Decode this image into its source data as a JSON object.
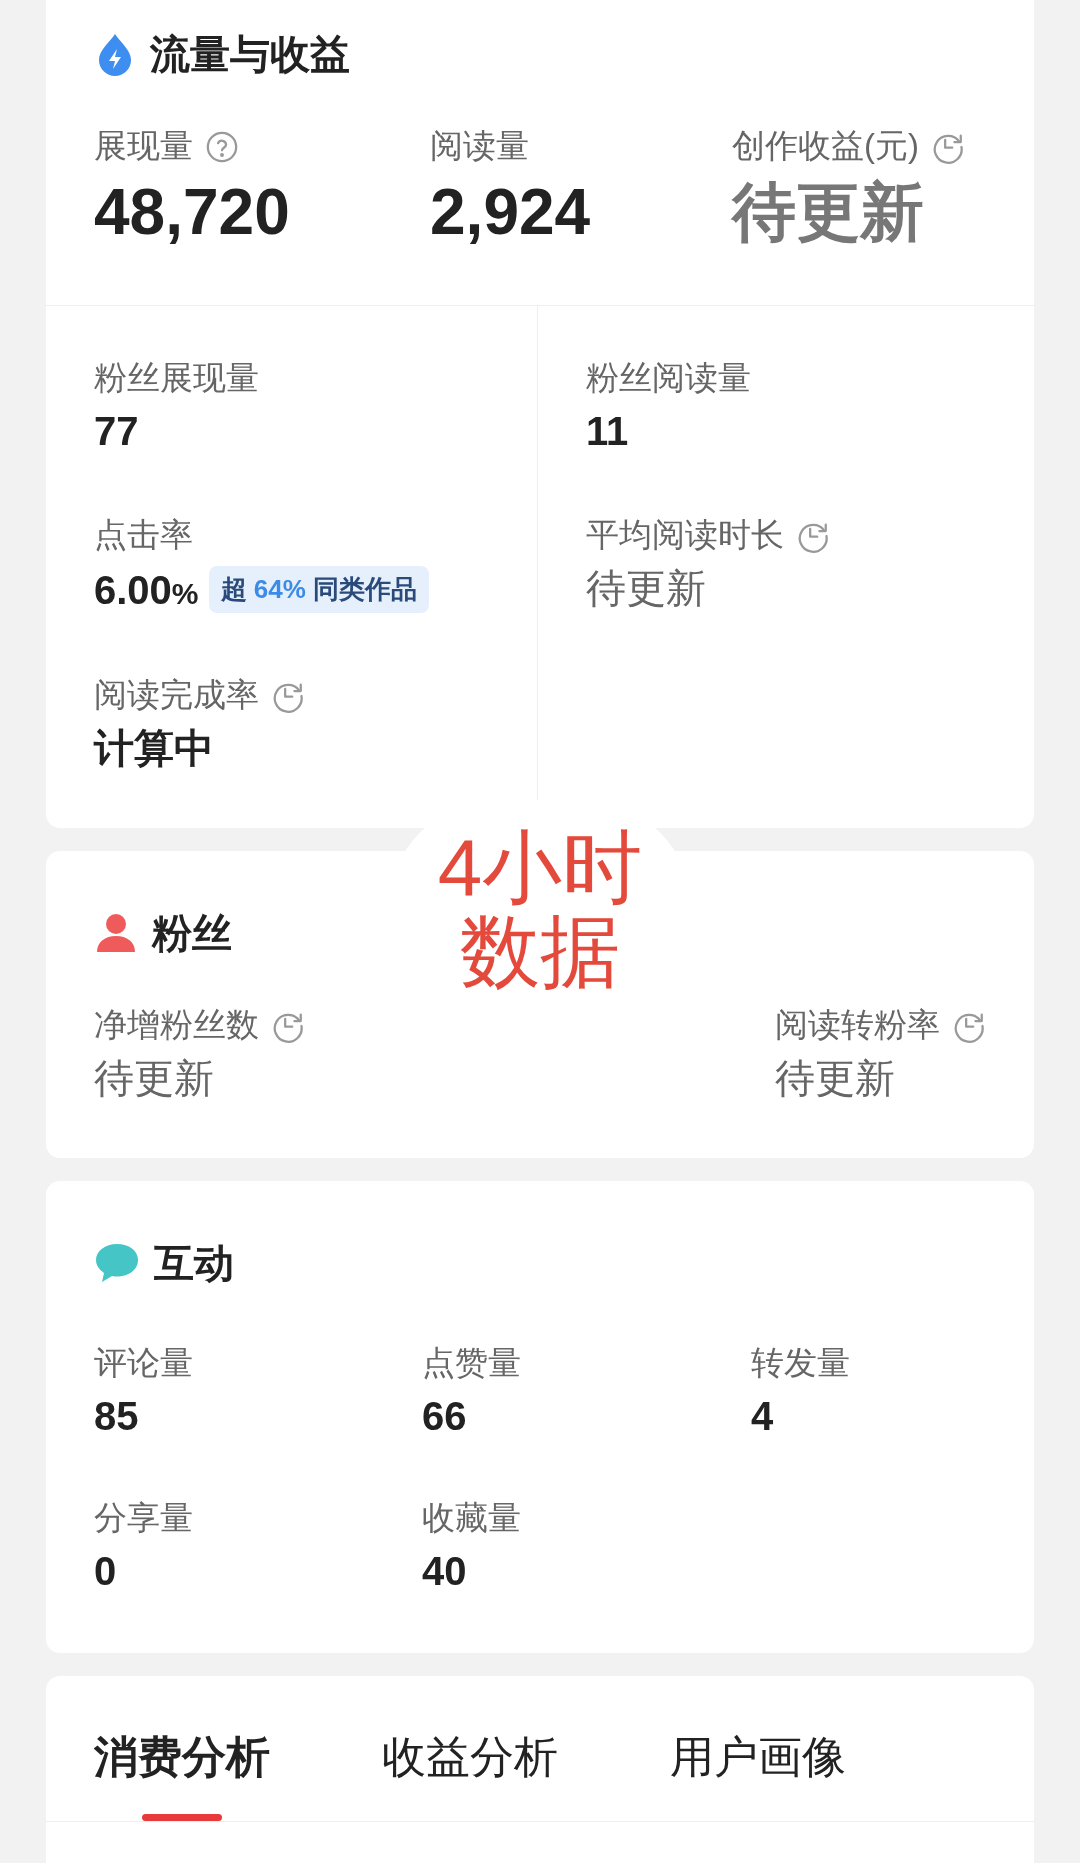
{
  "traffic": {
    "title": "流量与收益",
    "top_stats": [
      {
        "label": "展现量",
        "value": "48,720",
        "kind": "help",
        "pending": false
      },
      {
        "label": "阅读量",
        "value": "2,924",
        "pending": false
      },
      {
        "label": "创作收益(元)",
        "value": "待更新",
        "kind": "clock",
        "pending": true
      }
    ],
    "left_stats": [
      {
        "label": "粉丝展现量",
        "value": "77",
        "pending": false
      },
      {
        "label": "点击率",
        "value": "6.00",
        "unit": "%",
        "badge": "超 **64%** 同类作品",
        "pending": false
      },
      {
        "label": "阅读完成率",
        "value": "计算中",
        "kind": "clock",
        "pending": false
      }
    ],
    "right_stats": [
      {
        "label": "粉丝阅读量",
        "value": "11",
        "pending": false
      },
      {
        "label": "平均阅读时长",
        "value": "待更新",
        "kind": "clock",
        "pending": true
      }
    ]
  },
  "fans": {
    "title": "粉丝",
    "stats": [
      {
        "label": "净增粉丝数",
        "value": "待更新",
        "kind": "clock",
        "pending": true
      },
      {
        "label": "阅读转粉率",
        "value": "待更新",
        "kind": "clock",
        "pending": true
      }
    ]
  },
  "interaction": {
    "title": "互动",
    "stats": [
      {
        "label": "评论量",
        "value": "85"
      },
      {
        "label": "点赞量",
        "value": "66"
      },
      {
        "label": "转发量",
        "value": "4"
      },
      {
        "label": "分享量",
        "value": "0"
      },
      {
        "label": "收藏量",
        "value": "40"
      }
    ]
  },
  "tabs": [
    {
      "label": "消费分析",
      "selected": true
    },
    {
      "label": "收益分析",
      "selected": false
    },
    {
      "label": "用户画像",
      "selected": false
    }
  ],
  "annotation": {
    "lines": [
      "4小时",
      "数据"
    ]
  }
}
